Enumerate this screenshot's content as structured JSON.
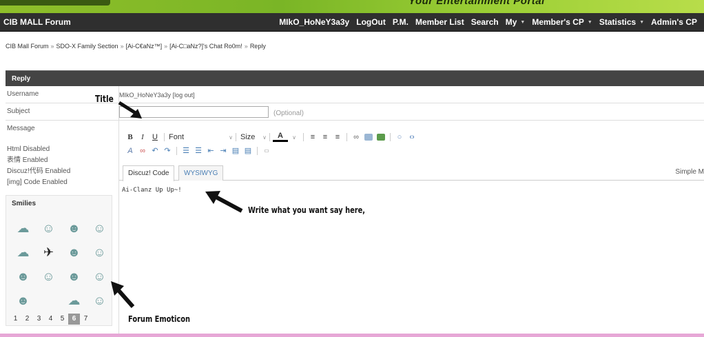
{
  "banner": {
    "tagline": "Your Entertainment Portal"
  },
  "nav": {
    "brand": "CIB MALL Forum",
    "items": [
      {
        "label": "MIkO_HoNeY3a3y",
        "dropdown": false
      },
      {
        "label": "LogOut",
        "dropdown": false
      },
      {
        "label": "P.M.",
        "dropdown": false
      },
      {
        "label": "Member List",
        "dropdown": false
      },
      {
        "label": "Search",
        "dropdown": false
      },
      {
        "label": "My",
        "dropdown": true
      },
      {
        "label": "Member's CP",
        "dropdown": true
      },
      {
        "label": "Statistics",
        "dropdown": true
      },
      {
        "label": "Admin's CP",
        "dropdown": false
      }
    ]
  },
  "breadcrumb": {
    "items": [
      "CIB Mall Forum",
      "SDO-X Family Section",
      "[Ai-C€aNz™]",
      "[Ai-C□aNz?]'s Chat Ro0m!",
      "Reply"
    ],
    "separator": "»"
  },
  "reply": {
    "header": "Reply",
    "username_label": "Username",
    "username_value": "MIkO_HoNeY3a3y",
    "logout_link": "[log out]",
    "subject_label": "Subject",
    "subject_value": "",
    "subject_hint": "(Optional)",
    "message_label": "Message",
    "status_lines": [
      "Html Disabled",
      "表情 Enabled",
      "Discuz!代码 Enabled",
      "[img] Code Enabled"
    ],
    "smilies_title": "Smilies",
    "pages": [
      "1",
      "2",
      "3",
      "4",
      "5",
      "6",
      "7"
    ],
    "active_page": "6"
  },
  "editor": {
    "font_label": "Font",
    "size_label": "Size",
    "tab_discuz": "Discuz! Code",
    "tab_wysiwyg": "WYSIWYG",
    "simple_mode": "Simple M",
    "content": "Ai-Clanz Up Up~!"
  },
  "annotations": {
    "title": "Title",
    "write_here": "Write what you want say here,",
    "emoticon": "Forum Emoticon"
  }
}
